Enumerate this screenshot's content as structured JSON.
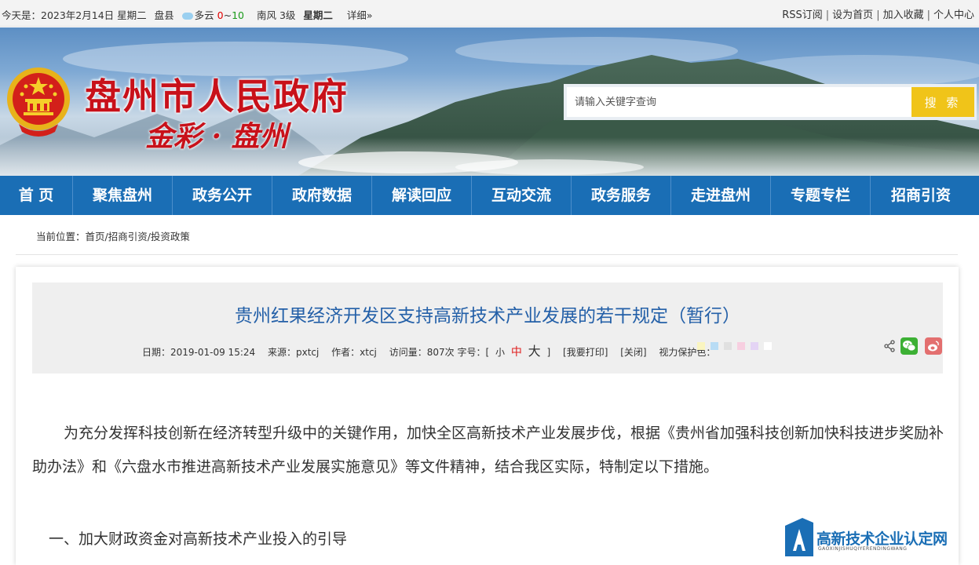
{
  "topbar": {
    "date_text": "今天是：2023年2月14日 星期二",
    "location": "盘县",
    "weather": "多云",
    "temp_low": "0",
    "temp_sep": "~",
    "temp_high": "10",
    "wind": "南风 3级",
    "day": "星期二",
    "detail_link": "详细»",
    "links": [
      "RSS订阅",
      "设为首页",
      "加入收藏",
      "个人中心"
    ]
  },
  "header": {
    "site_title": "盘州市人民政府",
    "slogan": "金彩 · 盘州",
    "search_placeholder": "请输入关键字查询",
    "search_button": "搜 索"
  },
  "nav": {
    "items": [
      "首 页",
      "聚焦盘州",
      "政务公开",
      "政府数据",
      "解读回应",
      "互动交流",
      "政务服务",
      "走进盘州",
      "专题专栏",
      "招商引资"
    ]
  },
  "breadcrumb": "当前位置：首页/招商引资/投资政策",
  "article": {
    "title": "贵州红果经济开发区支持高新技术产业发展的若干规定（暂行）",
    "date": "日期：2019-01-09 15:24",
    "source": "来源：pxtcj",
    "author": "作者：xtcj",
    "views": "访问量：807次",
    "font_size_label": "字号：[",
    "size_small": "小",
    "size_mid": "中",
    "size_big": "大",
    "size_close": "]",
    "print": "[我要打印]",
    "close": "[关闭]",
    "eye_protect": "视力保护色：",
    "swatch_colors": [
      "#faf5c0",
      "#b8dcf5",
      "#e0e0e0",
      "#f7cfe0",
      "#e4d4f5",
      "#ffffff"
    ],
    "paragraph": "为充分发挥科技创新在经济转型升级中的关键作用，加快全区高新技术产业发展步伐，根据《贵州省加强科技创新加快科技进步奖励补助办法》和《六盘水市推进高新技术产业发展实施意见》等文件精神，结合我区实际，特制定以下措施。",
    "section_heading": "一、加大财政资金对高新技术产业投入的引导"
  },
  "watermark": {
    "text": "高新技术企业认定网",
    "sub": "GAOXINJISHUQIYERENDINGWANG"
  },
  "colors": {
    "nav_bg": "#1a6eb5",
    "title_red": "#c8111a",
    "search_btn": "#f0c419",
    "article_title": "#2460a8"
  }
}
